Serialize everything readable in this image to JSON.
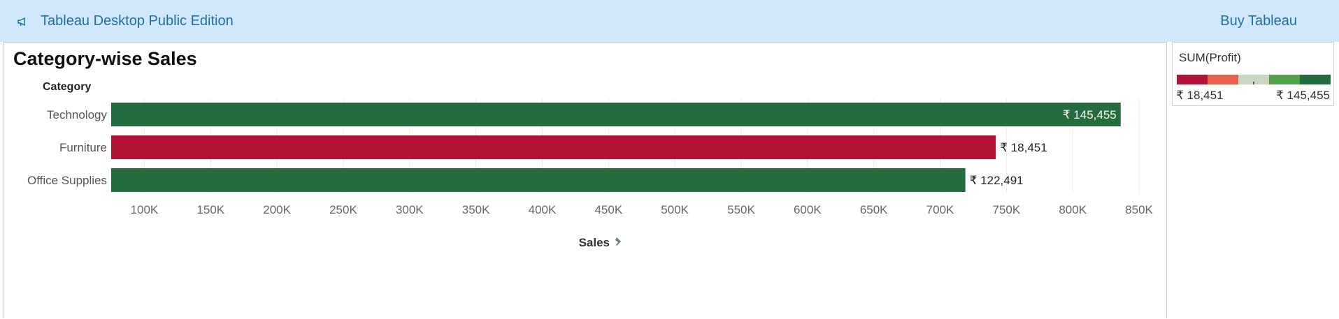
{
  "topbar": {
    "app_title": "Tableau Desktop Public Edition",
    "buy_label": "Buy Tableau",
    "icon": "megaphone-icon"
  },
  "worksheet": {
    "title": "Category-wise Sales",
    "row_header": "Category",
    "axis_label": "Sales",
    "pin_icon": "pin-icon"
  },
  "legend": {
    "title": "SUM(Profit)",
    "min_label": "₹ 18,451",
    "max_label": "₹ 145,455",
    "colors": [
      "#b11235",
      "#e8604c",
      "#c8d8c0",
      "#52a04a",
      "#246b3d"
    ]
  },
  "chart_data": {
    "type": "bar",
    "orientation": "horizontal",
    "title": "Category-wise Sales",
    "xlabel": "Sales",
    "ylabel": "Category",
    "categories": [
      "Technology",
      "Furniture",
      "Office Supplies"
    ],
    "values": [
      836154,
      741999,
      719047
    ],
    "profit": [
      145455,
      18451,
      122491
    ],
    "bar_labels": [
      "₹ 145,455",
      "₹ 18,451",
      "₹ 122,491"
    ],
    "bar_colors": [
      "#246b3d",
      "#b11235",
      "#246b3d"
    ],
    "xlim": [
      75000,
      860000
    ],
    "xticks": [
      100000,
      150000,
      200000,
      250000,
      300000,
      350000,
      400000,
      450000,
      500000,
      550000,
      600000,
      650000,
      700000,
      750000,
      800000,
      850000
    ],
    "xtick_labels": [
      "100K",
      "150K",
      "200K",
      "250K",
      "300K",
      "350K",
      "400K",
      "450K",
      "500K",
      "550K",
      "600K",
      "650K",
      "700K",
      "750K",
      "800K",
      "850K"
    ],
    "grid": true
  }
}
